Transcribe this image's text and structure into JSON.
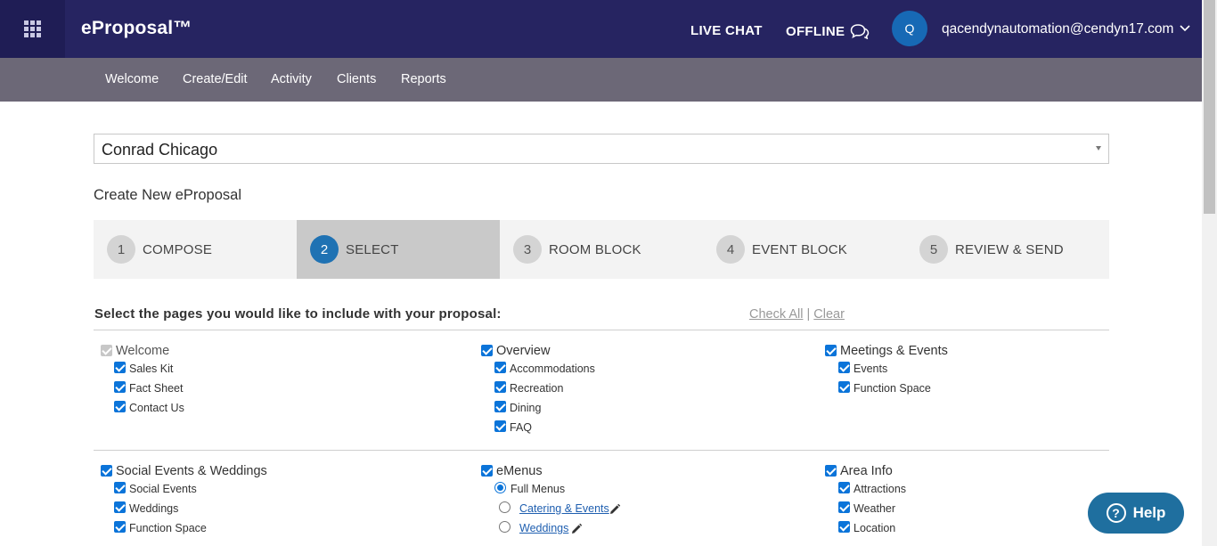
{
  "header": {
    "brand": "eProposal™",
    "live_chat": "LIVE CHAT",
    "offline": "OFFLINE",
    "avatar_initial": "Q",
    "user_email": "qacendynautomation@cendyn17.com"
  },
  "subnav": {
    "items": [
      "Welcome",
      "Create/Edit",
      "Activity",
      "Clients",
      "Reports"
    ]
  },
  "hotel_select": {
    "value": "Conrad Chicago"
  },
  "page_heading": "Create New eProposal",
  "steps": [
    {
      "num": "1",
      "label": "COMPOSE",
      "active": false
    },
    {
      "num": "2",
      "label": "SELECT",
      "active": true
    },
    {
      "num": "3",
      "label": "ROOM BLOCK",
      "active": false
    },
    {
      "num": "4",
      "label": "EVENT BLOCK",
      "active": false
    },
    {
      "num": "5",
      "label": "REVIEW & SEND",
      "active": false
    }
  ],
  "pages_section": {
    "title": "Select the pages you would like to include with your proposal:",
    "check_all": "Check All",
    "separator": "|",
    "clear": "Clear"
  },
  "groups": {
    "welcome": {
      "label": "Welcome",
      "checked": true,
      "disabled": true,
      "items": [
        "Sales Kit",
        "Fact Sheet",
        "Contact Us"
      ]
    },
    "overview": {
      "label": "Overview",
      "checked": true,
      "items": [
        "Accommodations",
        "Recreation",
        "Dining",
        "FAQ"
      ]
    },
    "meetings": {
      "label": "Meetings & Events",
      "checked": true,
      "items": [
        "Events",
        "Function Space"
      ]
    },
    "social": {
      "label": "Social Events & Weddings",
      "checked": true,
      "items": [
        "Social Events",
        "Weddings",
        "Function Space"
      ]
    },
    "emenus": {
      "label": "eMenus",
      "checked": true,
      "full_menus": "Full Menus",
      "menu_links": [
        "Catering & Events",
        "Weddings"
      ]
    },
    "area": {
      "label": "Area Info",
      "checked": true,
      "items": [
        "Attractions",
        "Weather",
        "Location"
      ]
    }
  },
  "help": {
    "label": "Help"
  },
  "colors": {
    "header_bg": "#262461",
    "subnav_bg": "#6c6877",
    "accent": "#1f72b3"
  }
}
